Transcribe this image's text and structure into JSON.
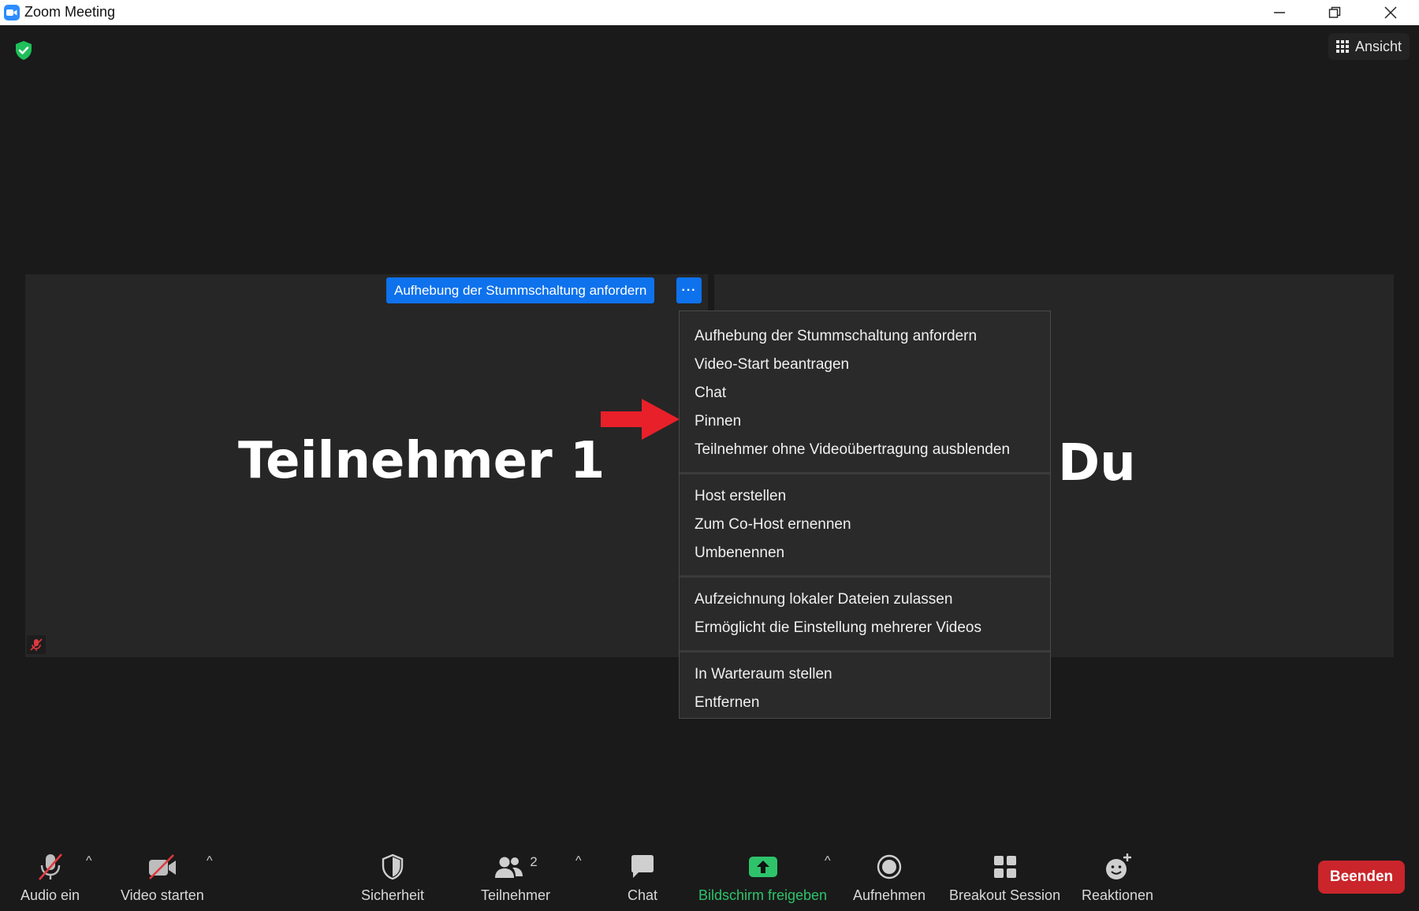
{
  "window": {
    "title": "Zoom Meeting"
  },
  "header": {
    "view_label": "Ansicht"
  },
  "tiles": {
    "left_name": "Teilnehmer 1",
    "right_name": "Du"
  },
  "hover": {
    "unmute_button": "Aufhebung der Stummschaltung anfordern",
    "more_button": "···"
  },
  "menu": {
    "group1": [
      "Aufhebung der Stummschaltung anfordern",
      "Video-Start beantragen",
      "Chat",
      "Pinnen",
      "Teilnehmer ohne Videoübertragung ausblenden"
    ],
    "group2": [
      "Host erstellen",
      "Zum Co-Host ernennen",
      "Umbenennen"
    ],
    "group3": [
      "Aufzeichnung lokaler Dateien zulassen",
      "Ermöglicht die Einstellung mehrerer Videos"
    ],
    "group4": [
      "In Warteraum stellen",
      "Entfernen"
    ]
  },
  "toolbar": {
    "audio": "Audio ein",
    "video": "Video starten",
    "security": "Sicherheit",
    "participants": "Teilnehmer",
    "participants_count": "2",
    "chat": "Chat",
    "share": "Bildschirm freigeben",
    "record": "Aufnehmen",
    "breakout": "Breakout Session",
    "reactions": "Reaktionen",
    "end": "Beenden"
  },
  "colors": {
    "accent_blue": "#0e72ed",
    "share_green": "#2ec36a",
    "end_red": "#c9252b",
    "arrow_red": "#e8202a",
    "background": "#1a1a1a"
  }
}
